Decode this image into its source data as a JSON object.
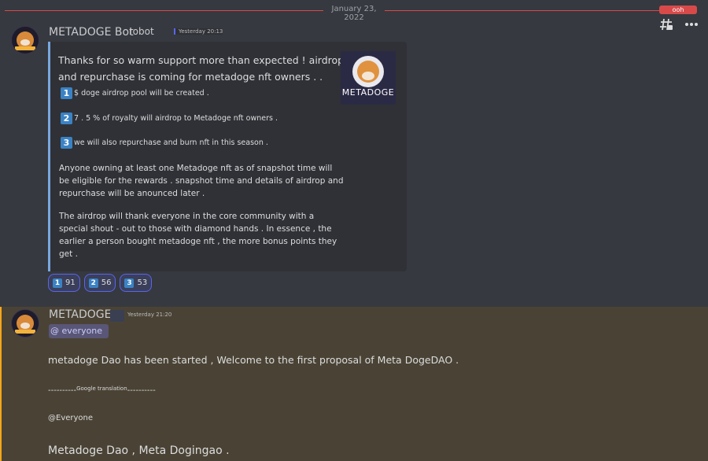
{
  "divider": {
    "date": "January 23, 2022",
    "badge": "ooh"
  },
  "toolbar": {
    "threads_icon": "threads-icon",
    "more_icon": "more-icon"
  },
  "message1": {
    "author": "METADOGE Bot",
    "bot_tag": "robot",
    "timestamp": "Yesterday 20:13",
    "embed": {
      "line1": "Thanks for so warm support more than expected !  airdrop",
      "line2": "and repurchase is coming for metadoge nft owners .      .",
      "items": [
        {
          "num": "1",
          "text": "$ doge airdrop pool will be created ."
        },
        {
          "num": "2",
          "text": "7 .  5 % of royalty will airdrop to Metadoge nft owners ."
        },
        {
          "num": "3",
          "text": "we will also repurchase and burn nft in this season ."
        }
      ],
      "para1": [
        "Anyone owning at least one Metadoge nft as of snapshot time will",
        "be eligible for the rewards .  snapshot time and details of airdrop and",
        "repurchase will be anounced later ."
      ],
      "para2": [
        "The airdrop will thank everyone in the core community with a",
        "special shout - out to those with diamond hands .  In essence , the",
        "earlier a person bought metadoge nft , the more bonus points they",
        "get ."
      ],
      "thumbnail_label": "METADOGE"
    },
    "reactions": [
      {
        "num": "1",
        "count": "91"
      },
      {
        "num": "2",
        "count": "56"
      },
      {
        "num": "3",
        "count": "53"
      }
    ]
  },
  "message2": {
    "author": "METADOGE",
    "timestamp": "Yesterday 21:20",
    "mention": "@ everyone",
    "line1": "metadoge Dao has been started , Welcome to the first proposal of Meta DogeDAO .",
    "line2_dashes_left": "----------",
    "line2_label": "Google translation",
    "line2_dashes_right": "----------",
    "line3": "@Everyone",
    "line4": "Metadoge Dao , Meta Dogingao ."
  }
}
